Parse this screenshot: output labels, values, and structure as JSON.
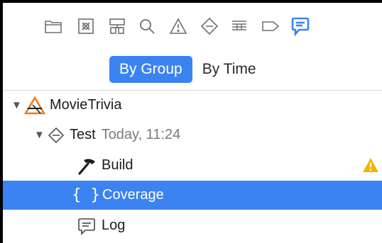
{
  "navigator": {
    "icons": [
      "folder-icon",
      "source-control-icon",
      "symbol-hierarchy-icon",
      "search-icon",
      "warning-icon",
      "breakpoint-test-icon",
      "debug-list-icon",
      "label-tag-icon",
      "report-message-icon"
    ],
    "selected_icon": "report-message-icon"
  },
  "filter": {
    "by_group": "By Group",
    "by_time": "By Time",
    "selected": "By Group"
  },
  "tree": {
    "project": {
      "name": "MovieTrivia"
    },
    "run": {
      "name": "Test",
      "time": "Today, 11:24"
    },
    "items": [
      {
        "label": "Build",
        "icon": "hammer-icon",
        "warning": true
      },
      {
        "label": "Coverage",
        "icon": "braces-icon",
        "selected": true
      },
      {
        "label": "Log",
        "icon": "log-message-icon"
      }
    ]
  },
  "colors": {
    "accent": "#3b83f0",
    "icon_gray": "#6f6f6f",
    "warning": "#f5b400"
  }
}
